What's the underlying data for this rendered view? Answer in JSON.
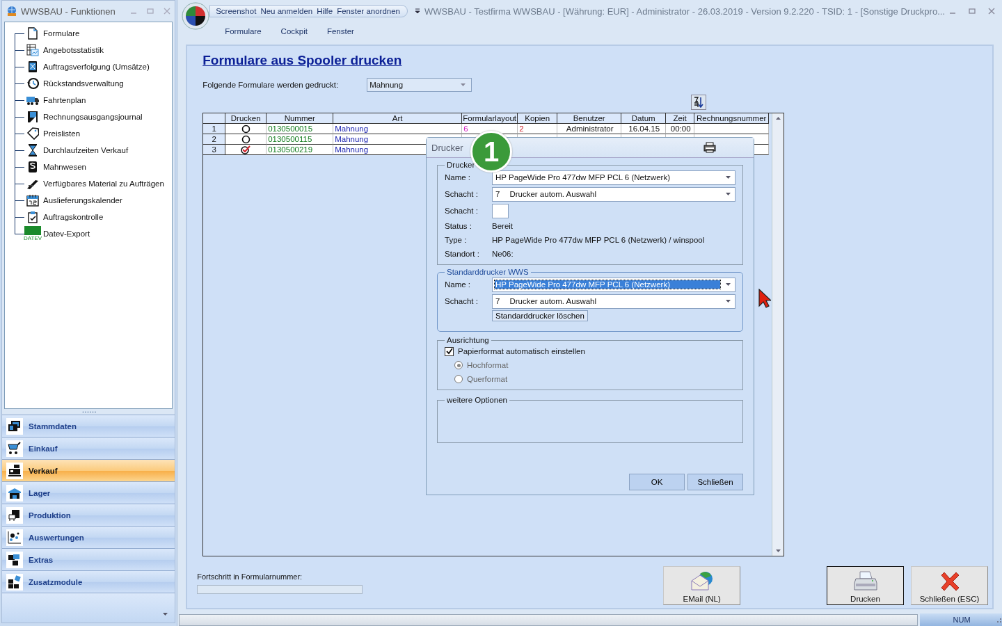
{
  "functions_panel": {
    "title": "WWSBAU - Funktionen",
    "tree": [
      {
        "label": "Formulare"
      },
      {
        "label": "Angebotsstatistik"
      },
      {
        "label": "Auftragsverfolgung (Umsätze)"
      },
      {
        "label": "Rückstandsverwaltung"
      },
      {
        "label": "Fahrtenplan"
      },
      {
        "label": "Rechnungsausgangsjournal"
      },
      {
        "label": "Preislisten"
      },
      {
        "label": "Durchlaufzeiten Verkauf"
      },
      {
        "label": "Mahnwesen"
      },
      {
        "label": "Verfügbares Material zu Aufträgen"
      },
      {
        "label": "Auslieferungskalender"
      },
      {
        "label": "Auftragskontrolle"
      },
      {
        "label": "Datev-Export",
        "badge": "DATEV"
      }
    ],
    "nav": [
      {
        "label": "Stammdaten",
        "selected": false
      },
      {
        "label": "Einkauf",
        "selected": false
      },
      {
        "label": "Verkauf",
        "selected": true
      },
      {
        "label": "Lager",
        "selected": false
      },
      {
        "label": "Produktion",
        "selected": false
      },
      {
        "label": "Auswertungen",
        "selected": false
      },
      {
        "label": "Extras",
        "selected": false
      },
      {
        "label": "Zusatzmodule",
        "selected": false
      }
    ]
  },
  "app": {
    "title": "WWSBAU - Testfirma WWSBAU - [Währung: EUR] - Administrator - 26.03.2019 - Version 9.2.220 - TSID: 1  - [Sonstige Druckpro...",
    "quick_access": [
      "Screenshot",
      "Neu anmelden",
      "Hilfe",
      "Fenster anordnen"
    ],
    "menu": [
      "Formulare",
      "Cockpit",
      "Fenster"
    ]
  },
  "page": {
    "heading": "Formulare aus Spooler drucken",
    "filter_label": "Folgende Formulare werden gedruckt:",
    "filter_value": "Mahnung",
    "table": {
      "columns": [
        "Drucken",
        "Nummer",
        "Art",
        "Formularlayout",
        "Kopien",
        "Benutzer",
        "Datum",
        "Zeit",
        "Rechnungsnummer"
      ],
      "rows": [
        {
          "index": "1",
          "checked": false,
          "cells": [
            null,
            "0130500015",
            "Mahnung",
            "6",
            "2",
            "Administrator",
            "16.04.15",
            "00:00",
            null
          ]
        },
        {
          "index": "2",
          "checked": false,
          "cells": [
            null,
            "0130500115",
            "Mahnung",
            null,
            null,
            null,
            null,
            null,
            null
          ]
        },
        {
          "index": "3",
          "checked": true,
          "cells": [
            null,
            "0130500219",
            "Mahnung",
            null,
            null,
            null,
            null,
            null,
            null
          ]
        }
      ]
    },
    "progress_label": "Fortschritt in Formularnummer:",
    "progress": {
      "level": 0
    },
    "buttons": [
      {
        "kind": "email",
        "label": "EMail (NL)",
        "default": false
      },
      {
        "kind": "print",
        "label": "Drucken",
        "default": true
      },
      {
        "kind": "close",
        "label": "Schließen (ESC)",
        "default": false
      }
    ]
  },
  "dialog": {
    "title": "Drucker",
    "step_badge": "1",
    "groups": [
      {
        "kind": "plain",
        "legend": "Drucker",
        "rows": [
          {
            "kind": "dropdown",
            "label": "Name :",
            "value": "HP PageWide Pro 477dw MFP PCL 6 (Netzwerk)",
            "text_selected": false
          },
          {
            "kind": "dropdown",
            "label": "Schacht :",
            "value": "7",
            "value_2": "Drucker autom. Auswahl",
            "text_selected": false
          },
          {
            "kind": "box",
            "label": "Schacht :"
          },
          {
            "kind": "text",
            "label": "Status :",
            "value": "Bereit"
          },
          {
            "kind": "text",
            "label": "Type :",
            "value": "HP PageWide Pro 477dw MFP PCL 6 (Netzwerk) / winspool"
          },
          {
            "kind": "text",
            "label": "Standort :",
            "value": "Ne06:"
          }
        ]
      },
      {
        "kind": "rounded",
        "legend": "Standarddrucker WWS",
        "rows": [
          {
            "kind": "dropdown",
            "label": "Name :",
            "value": "HP PageWide Pro 477dw MFP PCL 6 (Netzwerk)",
            "text_selected": true
          },
          {
            "kind": "dropdown",
            "label": "Schacht :",
            "value": "7",
            "value_2": "Drucker autom. Auswahl",
            "text_selected": false
          }
        ],
        "button": "Standarddrucker löschen"
      },
      {
        "kind": "plain",
        "legend": "Ausrichtung",
        "checkbox": {
          "label": "Papierformat automatisch einstellen",
          "checked": true
        },
        "radios": [
          {
            "label": "Hochformat",
            "selected": true,
            "disabled": true
          },
          {
            "label": "Querformat",
            "selected": false,
            "disabled": true
          }
        ]
      },
      {
        "kind": "plain",
        "legend": "weitere Optionen"
      }
    ],
    "buttons": [
      "OK",
      "Schließen"
    ]
  },
  "status_bar": {
    "indicator": "NUM"
  }
}
